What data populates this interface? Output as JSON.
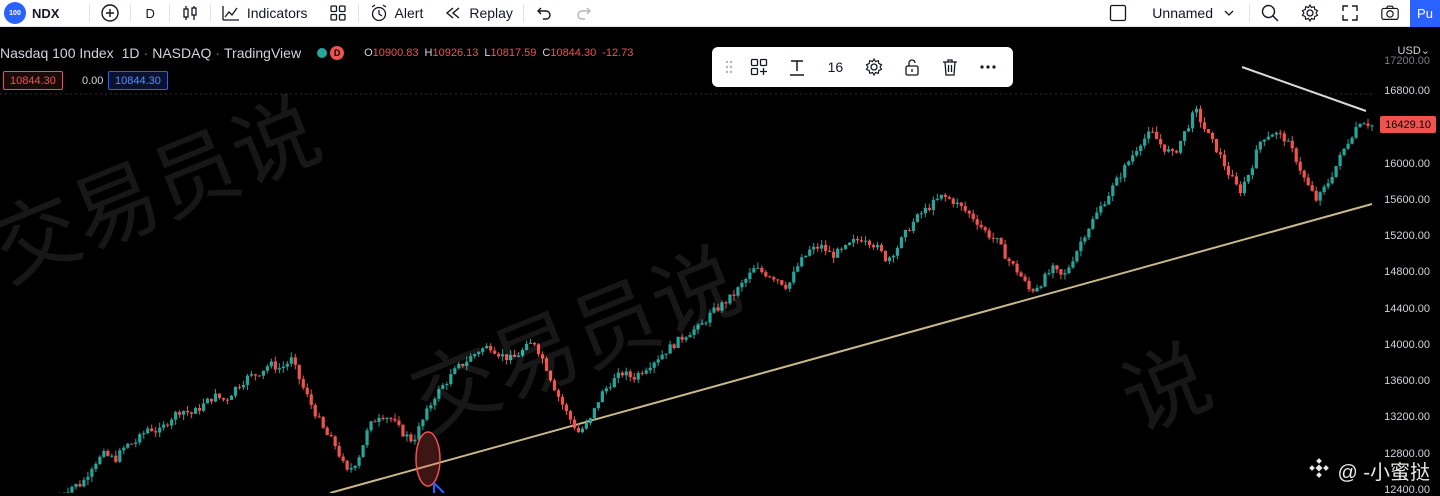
{
  "topbar": {
    "logo_text": "100",
    "symbol": "NDX",
    "interval": "D",
    "indicators_label": "Indicators",
    "alert_label": "Alert",
    "replay_label": "Replay",
    "layout_name": "Unnamed",
    "publish_label": "Pu"
  },
  "legend": {
    "title": "Nasdaq 100 Index",
    "interval": "1D",
    "exchange": "NASDAQ",
    "source": "TradingView",
    "badge": "D",
    "open_key": "O",
    "open": "10900.83",
    "high_key": "H",
    "high": "10926.13",
    "low_key": "L",
    "low": "10817.59",
    "close_key": "C",
    "close": "10844.30",
    "change": "-12.73"
  },
  "price_boxes": {
    "sell": "10844.30",
    "spread": "0.00",
    "buy": "10844.30"
  },
  "drawing_toolbar": {
    "font_size": "16"
  },
  "axis": {
    "currency": "USD",
    "current_price": "16429.10"
  },
  "colors": {
    "up": "#26a69a",
    "down": "#ef5350",
    "trendline": "#c9b98a",
    "accent": "#2962ff"
  },
  "watermarks": [
    "交易员说",
    "交易员说",
    "说"
  ],
  "credit": "@ -小蜜挞",
  "chart_data": {
    "type": "candlestick",
    "y_ticks": [
      16800,
      16400,
      16000,
      15600,
      15200,
      14800,
      14400,
      14000,
      13600,
      13200,
      12800,
      12400
    ],
    "ylim": [
      12400,
      17200
    ],
    "trend_close": [
      12350,
      12450,
      12480,
      12700,
      12800,
      12750,
      12900,
      12950,
      13100,
      13050,
      13200,
      13300,
      13250,
      13350,
      13450,
      13400,
      13550,
      13650,
      13700,
      13800,
      13750,
      13850,
      13550,
      13300,
      13050,
      12900,
      12600,
      12750,
      13100,
      13250,
      13200,
      13050,
      12950,
      13200,
      13450,
      13600,
      13750,
      13850,
      13950,
      14000,
      13900,
      13850,
      13950,
      14050,
      13800,
      13500,
      13250,
      13050,
      13150,
      13450,
      13600,
      13700,
      13650,
      13750,
      13850,
      13950,
      14050,
      14150,
      14200,
      14350,
      14450,
      14550,
      14700,
      14850,
      14800,
      14750,
      14650,
      14900,
      15050,
      15100,
      15000,
      15050,
      15150,
      15200,
      15100,
      14950,
      15100,
      15300,
      15450,
      15550,
      15650,
      15600,
      15500,
      15400,
      15250,
      15150,
      14950,
      14800,
      14600,
      14700,
      14850,
      14750,
      15000,
      15250,
      15450,
      15650,
      15850,
      16050,
      16250,
      16350,
      16200,
      16100,
      16350,
      16600,
      16350,
      16150,
      15900,
      15700,
      15950,
      16300,
      16350,
      16300,
      16100,
      15800,
      15600,
      15800,
      16050,
      16300,
      16500,
      16429
    ]
  }
}
